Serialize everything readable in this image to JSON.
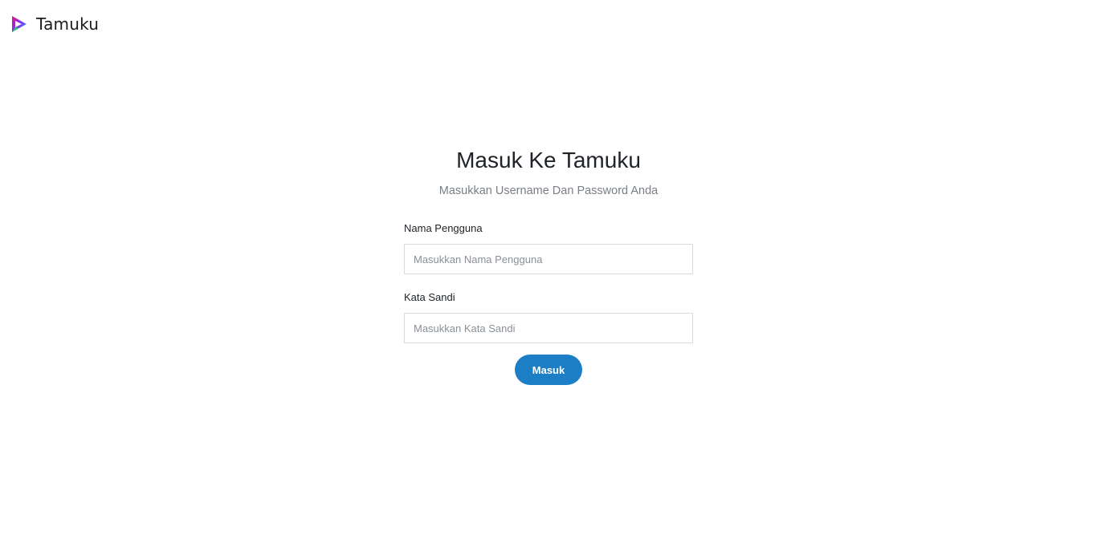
{
  "header": {
    "brand_name": "Tamuku",
    "logo_icon": "play-triangle-logo-icon",
    "logo_colors": [
      "#e6187a",
      "#7b2ff7",
      "#1fb5e8",
      "#35c46a"
    ]
  },
  "login": {
    "title": "Masuk Ke Tamuku",
    "subtitle": "Masukkan Username Dan Password Anda",
    "username": {
      "label": "Nama Pengguna",
      "placeholder": "Masukkan Nama Pengguna",
      "value": ""
    },
    "password": {
      "label": "Kata Sandi",
      "placeholder": "Masukkan Kata Sandi",
      "value": ""
    },
    "submit_label": "Masuk"
  },
  "colors": {
    "accent": "#1c7fc6",
    "background": "#ffffff"
  }
}
